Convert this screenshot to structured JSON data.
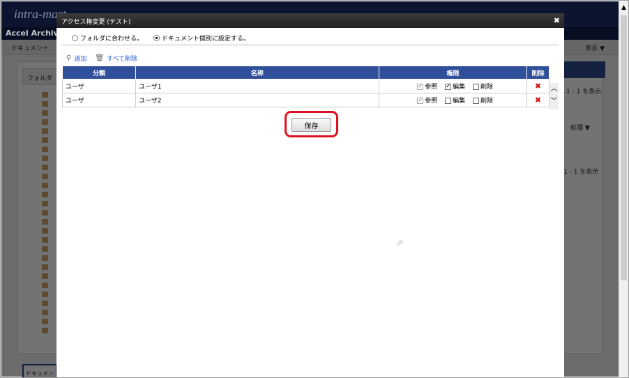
{
  "background": {
    "logo": "intra-mart",
    "app_title": "Accel Archiv",
    "toolbar_doc": "ドキュメント",
    "view_label": "表示 ▼",
    "folder_header": "フォルダ",
    "right_count": "1 - 1 を表示",
    "process_label": "処理 ▼",
    "bottom_count": "1 - 1 を表示",
    "bottom_tab": "ドキュメン"
  },
  "dialog": {
    "title": "アクセス権変更 (テスト)",
    "close_icon": "close-icon",
    "radio_options": [
      {
        "label": "フォルダに合わせる。",
        "selected": false
      },
      {
        "label": "ドキュメント個別に設定する。",
        "selected": true
      }
    ],
    "add_label": "追加",
    "delete_all_label": "すべて削除",
    "table": {
      "headers": [
        "分類",
        "名称",
        "権限",
        "削除"
      ],
      "permission_labels": [
        "参照",
        "編集",
        "削除"
      ],
      "rows": [
        {
          "type": "ユーザ",
          "name": "ユーザ1",
          "view": true,
          "edit": true,
          "delete": false
        },
        {
          "type": "ユーザ",
          "name": "ユーザ2",
          "view": true,
          "edit": false,
          "delete": false
        }
      ]
    },
    "save_label": "保存",
    "highlight_color": "#e01020",
    "header_color": "#2f4f9a"
  }
}
